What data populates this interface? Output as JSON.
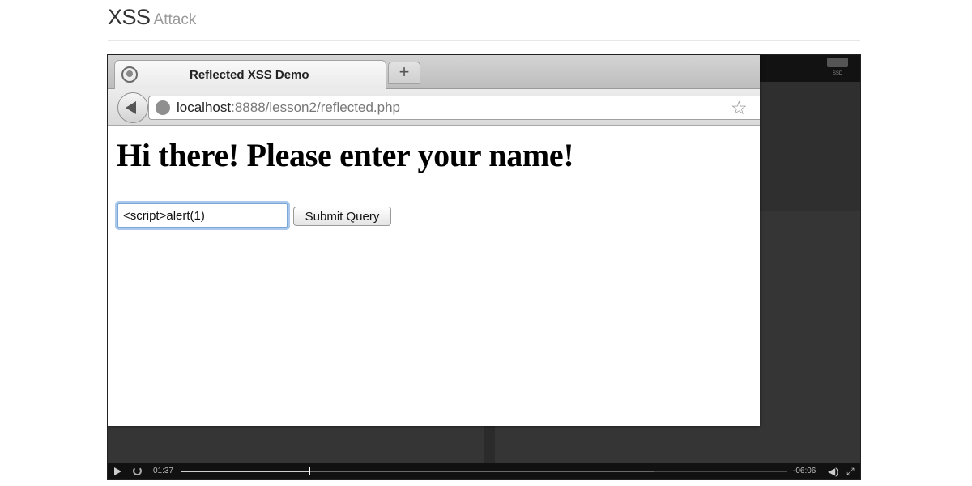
{
  "header": {
    "title": "XSS",
    "subtitle": "Attack"
  },
  "browser": {
    "tab_title": "Reflected XSS Demo",
    "new_tab_label": "+",
    "url_host": "localhost",
    "url_path": ":8888/lesson2/reflected.php",
    "heading": "Hi there! Please enter your name!",
    "name_input_value": "<script>alert(1)",
    "submit_label": "Submit Query"
  },
  "player": {
    "tray_label": "SSD",
    "elapsed": "01:37",
    "remaining": "-06:06",
    "progress_fraction": 0.21
  },
  "icons": {
    "play": "play-icon",
    "replay": "replay-icon",
    "volume": "volume-icon",
    "fullscreen": "fullscreen-icon",
    "back": "back-arrow-icon",
    "bookmark": "star-icon",
    "site": "globe-icon"
  }
}
